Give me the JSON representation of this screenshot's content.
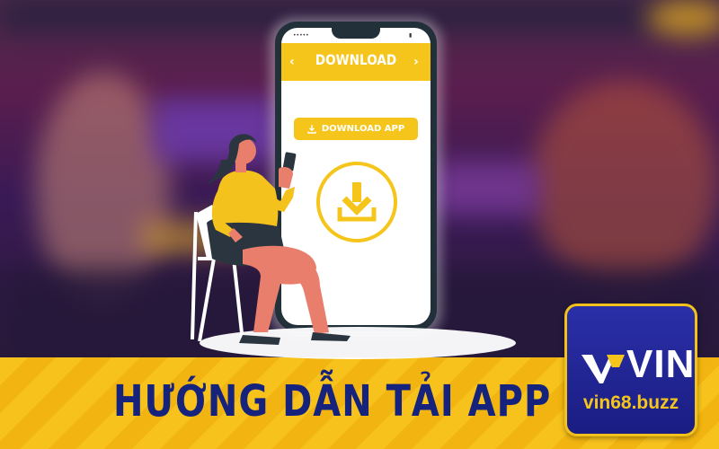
{
  "phone": {
    "status_left": "•••••",
    "status_right": "▮",
    "header_title": "DOWNLOAD",
    "prev_icon": "chevron-left-icon",
    "next_icon": "chevron-right-icon",
    "download_button_label": "DOWNLOAD APP",
    "download_button_icon": "download-icon",
    "download_circle_icon": "download-icon"
  },
  "banner": {
    "title": "HƯỚNG DẪN TẢI APP"
  },
  "logo": {
    "word": "VIN",
    "domain": "vin68.buzz"
  },
  "colors": {
    "accent_yellow": "#f5c51b",
    "banner_yellow": "#f7c21c",
    "navy": "#16237d",
    "logo_blue": "#2a2fa8",
    "phone_frame": "#22303a",
    "skin": "#e97e6d",
    "shirt": "#f4c21c",
    "skirt": "#2b3540"
  }
}
